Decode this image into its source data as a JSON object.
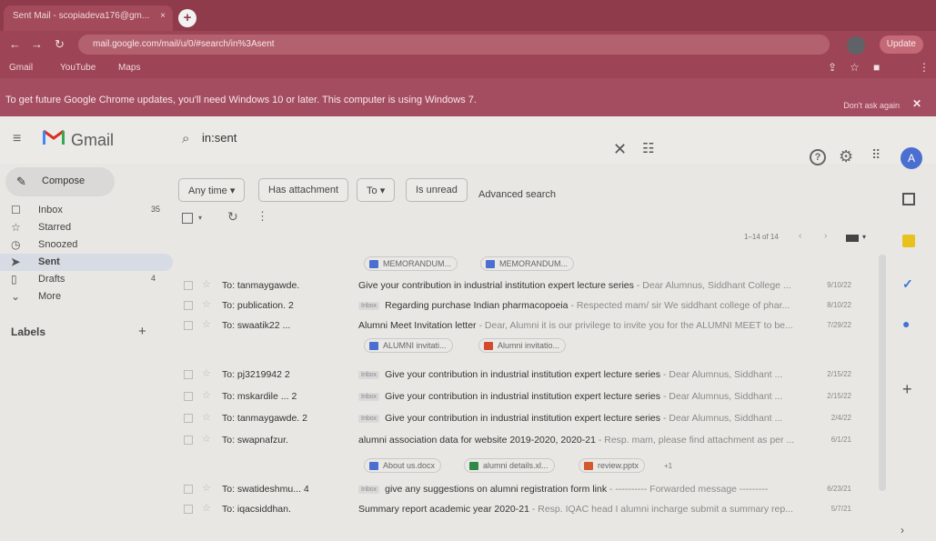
{
  "browser": {
    "tab_title": "Sent Mail - scopiadeva176@gm...",
    "tab_close": "×",
    "new_tab": "+",
    "url": "mail.google.com/mail/u/0/#search/in%3Asent",
    "profile_label": "Update",
    "bookmarks": [
      "Gmail",
      "YouTube",
      "Maps"
    ],
    "infobar_message": "To get future Google Chrome updates, you'll need Windows 10 or later. This computer is using Windows 7.",
    "infobar_dismiss": "Don't ask again"
  },
  "gmail": {
    "product": "Gmail",
    "search_value": "in:sent",
    "avatar_letter": "A"
  },
  "sidebar": {
    "compose": "Compose",
    "items": [
      {
        "label": "Inbox",
        "count": "35"
      },
      {
        "label": "Starred",
        "count": ""
      },
      {
        "label": "Snoozed",
        "count": ""
      },
      {
        "label": "Sent",
        "count": ""
      },
      {
        "label": "Drafts",
        "count": "4"
      },
      {
        "label": "More",
        "count": ""
      }
    ],
    "labels_heading": "Labels",
    "labels_add": "+"
  },
  "filters": {
    "any_time": "Any time",
    "has_attachment": "Has attachment",
    "to": "To",
    "is_unread": "Is unread",
    "advanced": "Advanced search"
  },
  "pager": {
    "range": "1–14 of 14"
  },
  "rows": [
    {
      "sender": "To: tanmaygawde.",
      "tag": "",
      "subject": "Give your contribution in industrial institution expert lecture series",
      "snippet": " - Dear Alumnus, Siddhant College ...",
      "date": "9/10/22"
    },
    {
      "sender": "To: publication. 2",
      "tag": "Inbox",
      "subject": "Regarding purchase Indian pharmacopoeia",
      "snippet": " - Respected mam/ sir We siddhant college of phar...",
      "date": "8/10/22"
    },
    {
      "sender": "To: swaatik22 ...",
      "tag": "",
      "subject": "Alumni Meet Invitation letter",
      "snippet": " - Dear, Alumni it is our privilege to invite you for the ALUMNI MEET to be...",
      "date": "7/29/22"
    },
    {
      "sender": "To: pj3219942 2",
      "tag": "Inbox",
      "subject": "Give your contribution in industrial institution expert lecture series",
      "snippet": " - Dear Alumnus, Siddhant ...",
      "date": "2/15/22"
    },
    {
      "sender": "To: mskardile ... 2",
      "tag": "Inbox",
      "subject": "Give your contribution in industrial institution expert lecture series",
      "snippet": " - Dear Alumnus, Siddhant ...",
      "date": "2/15/22"
    },
    {
      "sender": "To: tanmaygawde. 2",
      "tag": "Inbox",
      "subject": "Give your contribution in industrial institution expert lecture series",
      "snippet": " - Dear Alumnus, Siddhant ...",
      "date": "2/4/22"
    },
    {
      "sender": "To: swapnafzur.",
      "tag": "",
      "subject": "alumni association data for website 2019-2020, 2020-21",
      "snippet": " - Resp. mam, please find attachment as per ...",
      "date": "6/1/21"
    },
    {
      "sender": "To: swatideshmu... 4",
      "tag": "Inbox",
      "subject": "give any suggestions on alumni registration form link",
      "snippet": " - ---------- Forwarded message ---------",
      "date": "6/23/21"
    },
    {
      "sender": "To: iqacsiddhan.",
      "tag": "",
      "subject": "Summary report academic year 2020-21",
      "snippet": " - Resp. IQAC head I alumni incharge submit a summary rep...",
      "date": "5/7/21"
    }
  ],
  "attachments": {
    "row1": [
      "MEMORANDUM...",
      "MEMORANDUM..."
    ],
    "row3": [
      "ALUMNI invitati...",
      "Alumni invitatio..."
    ],
    "row7": [
      "About us.docx",
      "alumni details.xl...",
      "review.pptx"
    ],
    "row7_more": "+1"
  },
  "colors": {
    "tab_bar": "#8f3b4c",
    "infobar": "#a44d60",
    "active_nav": "#d7dbe4",
    "accent_blue": "#4a6fd1"
  }
}
